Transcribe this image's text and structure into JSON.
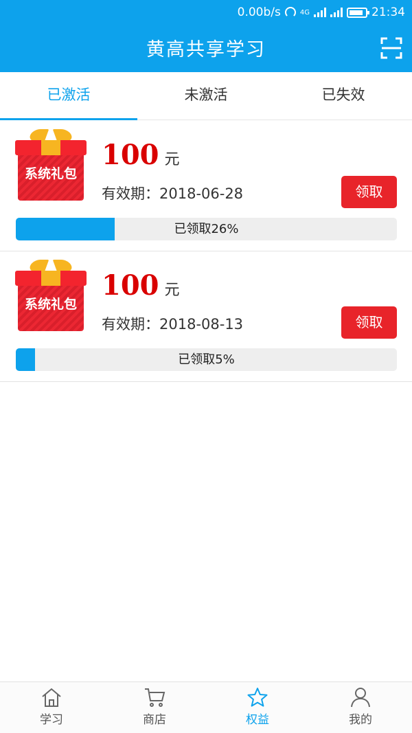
{
  "status": {
    "speed": "0.00b/s",
    "network": "4G",
    "time": "21:34",
    "battery_fraction": 0.85
  },
  "header": {
    "title": "黄高共享学习",
    "scan_icon": "scan-icon"
  },
  "tabs": [
    {
      "label": "已激活",
      "active": true
    },
    {
      "label": "未激活",
      "active": false
    },
    {
      "label": "已失效",
      "active": false
    }
  ],
  "coupons": [
    {
      "badge": "系统礼包",
      "amount": "100",
      "unit": "元",
      "validity": "有效期：2018-06-28",
      "button": "领取",
      "progress_text": "已领取26%",
      "progress_value": 0.26
    },
    {
      "badge": "系统礼包",
      "amount": "100",
      "unit": "元",
      "validity": "有效期：2018-08-13",
      "button": "领取",
      "progress_text": "已领取5%",
      "progress_value": 0.05
    }
  ],
  "nav": [
    {
      "label": "学习",
      "icon": "home-icon",
      "active": false
    },
    {
      "label": "商店",
      "icon": "cart-icon",
      "active": false
    },
    {
      "label": "权益",
      "icon": "star-icon",
      "active": true
    },
    {
      "label": "我的",
      "icon": "user-icon",
      "active": false
    }
  ],
  "colors": {
    "primary": "#0da2ec",
    "amount": "#d90000",
    "button": "#e8242a"
  }
}
